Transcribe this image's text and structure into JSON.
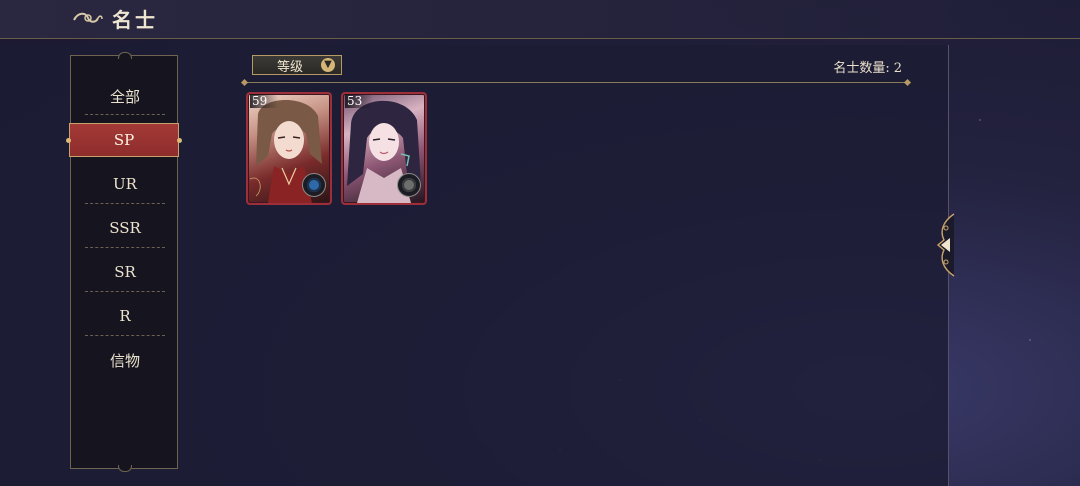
{
  "header": {
    "title": "名士",
    "icon": "cloud-swirl-icon"
  },
  "sidebar": {
    "items": [
      {
        "label": "全部",
        "active": false
      },
      {
        "label": "SP",
        "active": true
      },
      {
        "label": "UR",
        "active": false
      },
      {
        "label": "SSR",
        "active": false
      },
      {
        "label": "SR",
        "active": false
      },
      {
        "label": "R",
        "active": false
      },
      {
        "label": "信物",
        "active": false
      }
    ]
  },
  "toolbar": {
    "sort_label": "等级",
    "sort_icon": "chevron-down-icon",
    "count_label": "名士数量:",
    "count_value": "2"
  },
  "cards": [
    {
      "level": "59",
      "emblem": "blue-element-icon"
    },
    {
      "level": "53",
      "emblem": "grey-element-icon"
    }
  ],
  "colors": {
    "accent_gold": "#b59a64",
    "active_red": "#a33a37",
    "panel_bg": "#1c1c34"
  }
}
